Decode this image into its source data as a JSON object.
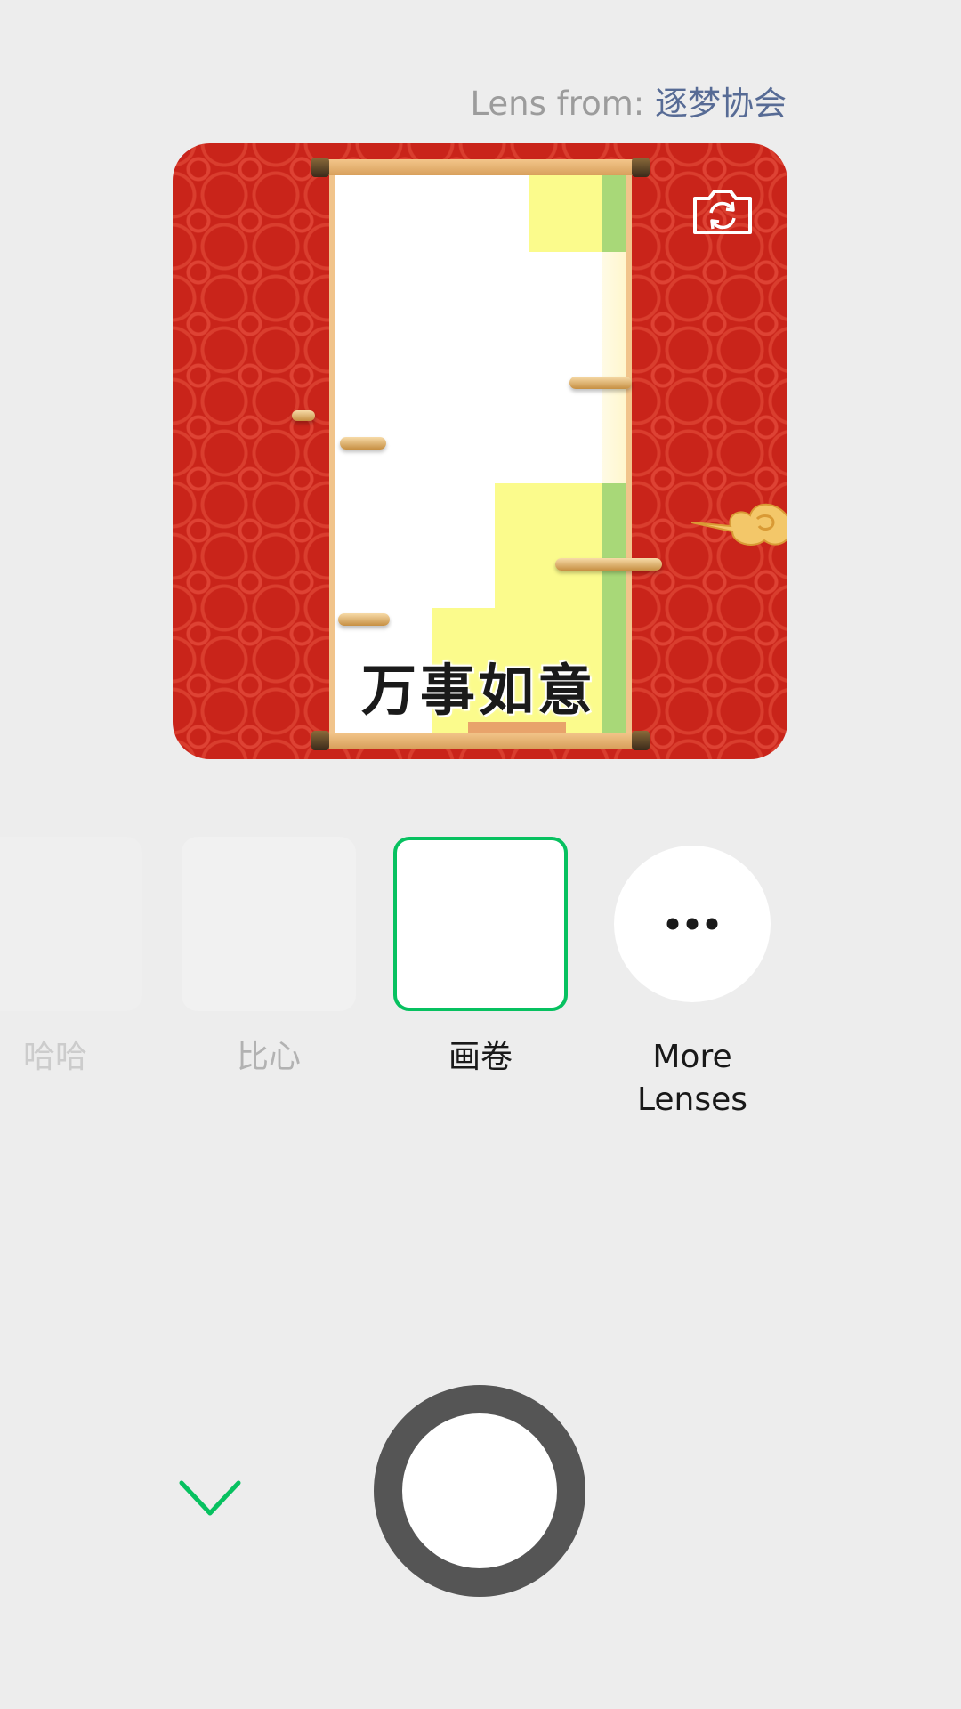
{
  "header": {
    "lens_from_label": "Lens from: ",
    "lens_author": "逐梦协会"
  },
  "preview": {
    "scroll_text": "万事如意",
    "switch_camera_icon": "camera-switch-icon",
    "colors": {
      "background": "#c9241a",
      "scroll_border": "#f1c48b",
      "yellow": "#fbfb8c",
      "green": "#a8d878"
    }
  },
  "lenses": [
    {
      "label": "哈哈",
      "state": "unselected"
    },
    {
      "label": "比心",
      "state": "unselected"
    },
    {
      "label": "画卷",
      "state": "selected"
    }
  ],
  "more": {
    "label": "More\nLenses",
    "icon": "more-dots-icon"
  },
  "controls": {
    "collapse_icon": "chevron-down-icon",
    "shutter_icon": "shutter-button",
    "accent": "#07c160"
  }
}
